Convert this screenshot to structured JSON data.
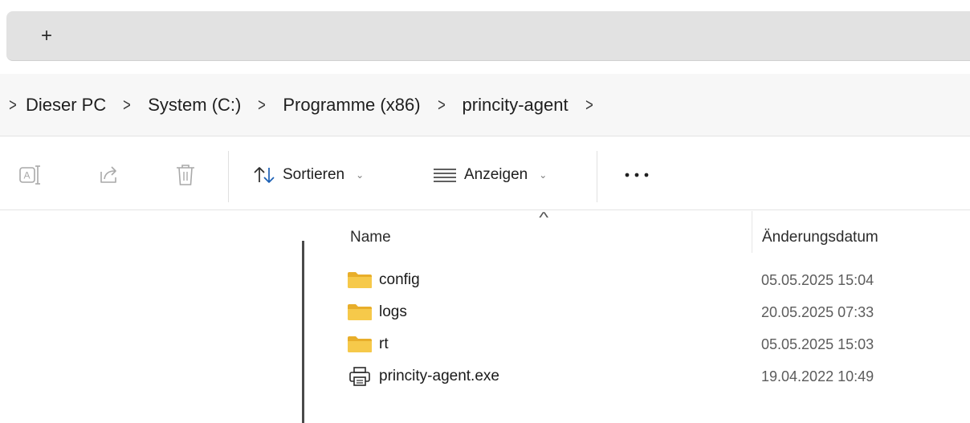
{
  "tabbar": {
    "new_tab_label": "+"
  },
  "breadcrumb": {
    "items": [
      "Dieser PC",
      "System (C:)",
      "Programme (x86)",
      "princity-agent"
    ]
  },
  "toolbar": {
    "sort_label": "Sortieren",
    "view_label": "Anzeigen",
    "more_label": "•••"
  },
  "list": {
    "columns": {
      "name": "Name",
      "modified": "Änderungsdatum"
    },
    "rows": [
      {
        "name": "config",
        "modified": "05.05.2025 15:04",
        "type": "folder"
      },
      {
        "name": "logs",
        "modified": "20.05.2025 07:33",
        "type": "folder"
      },
      {
        "name": "rt",
        "modified": "05.05.2025 15:03",
        "type": "folder"
      },
      {
        "name": "princity-agent.exe",
        "modified": "19.04.2022 10:49",
        "type": "exe"
      }
    ]
  },
  "colors": {
    "folder": "#f4c542",
    "folder_dark": "#e0a820",
    "icon_disabled": "#a9a9a9",
    "accent": "#1a5fb4"
  }
}
